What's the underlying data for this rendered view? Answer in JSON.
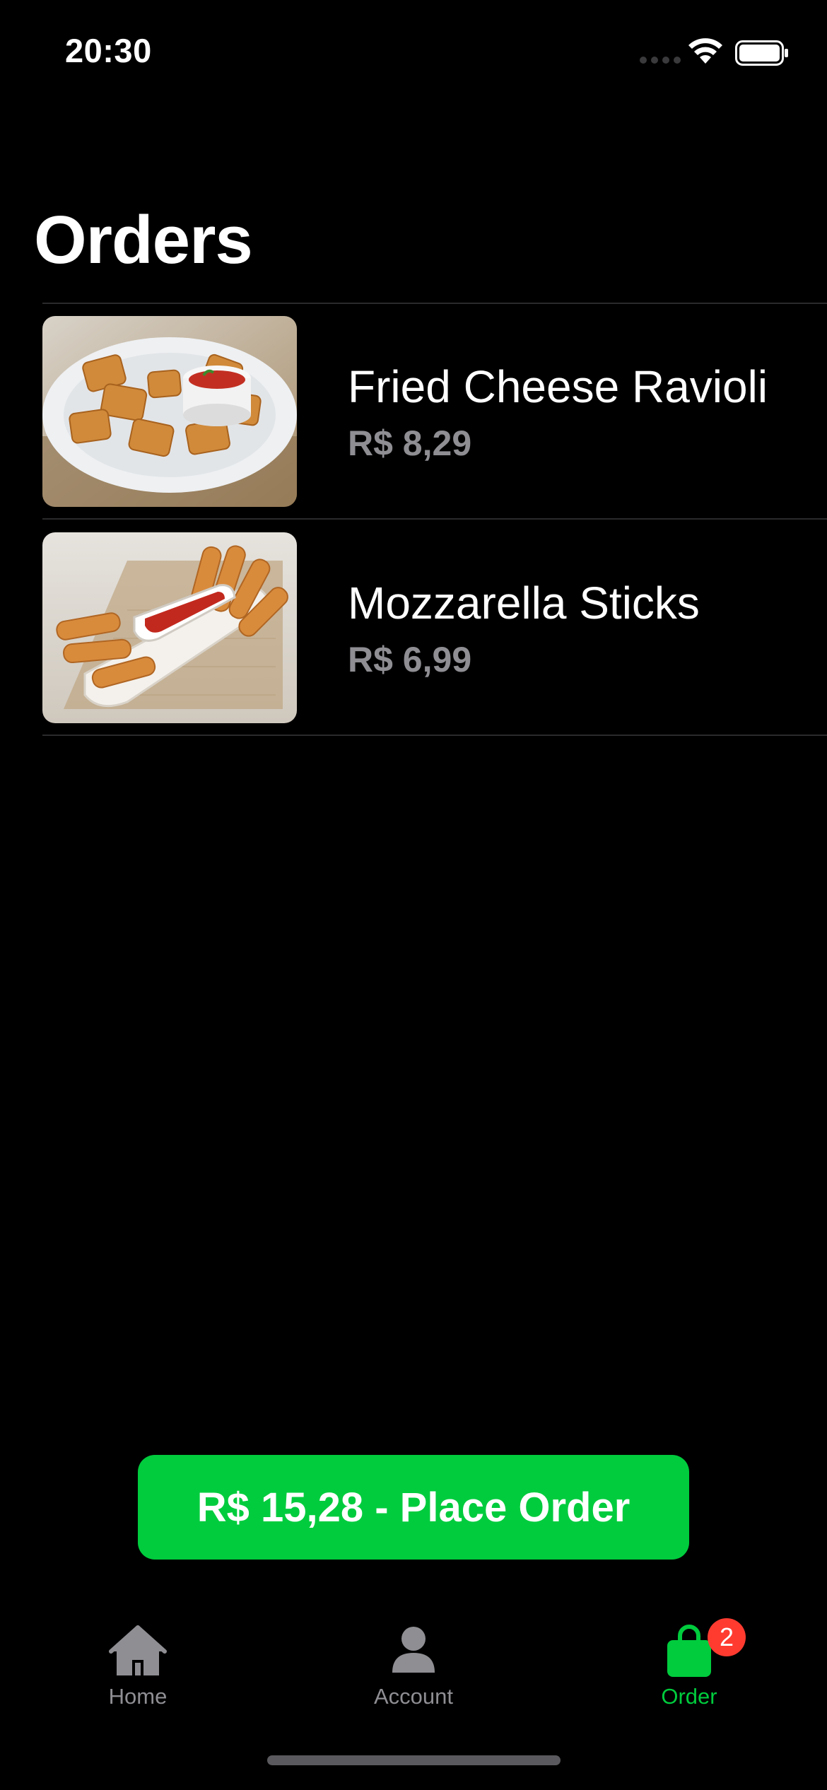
{
  "status_bar": {
    "time": "20:30"
  },
  "page": {
    "title": "Orders"
  },
  "orders": [
    {
      "name": "Fried Cheese Ravioli",
      "price": "R$ 8,29",
      "image": "fried-ravioli-photo"
    },
    {
      "name": "Mozzarella Sticks",
      "price": "R$ 6,99",
      "image": "mozzarella-sticks-photo"
    }
  ],
  "place_order": {
    "label": "R$ 15,28 - Place Order"
  },
  "tab_bar": {
    "items": [
      {
        "label": "Home",
        "icon": "house-icon",
        "active": false
      },
      {
        "label": "Account",
        "icon": "person-icon",
        "active": false
      },
      {
        "label": "Order",
        "icon": "bag-icon",
        "active": true,
        "badge": "2"
      }
    ]
  },
  "colors": {
    "accent": "#00cc3d",
    "badge": "#ff3b30",
    "secondary_text": "#8e8e93",
    "background": "#000000"
  }
}
